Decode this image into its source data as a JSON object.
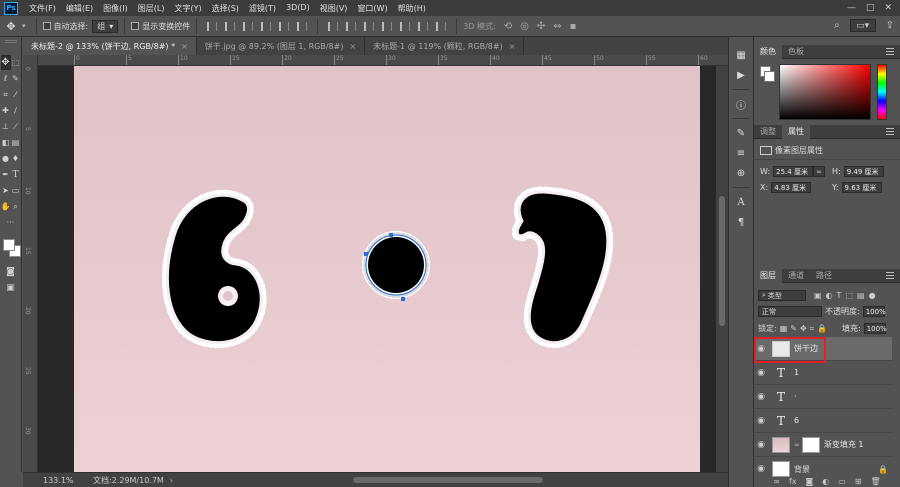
{
  "app": {
    "logo": "Ps"
  },
  "menu": [
    "文件(F)",
    "编辑(E)",
    "图像(I)",
    "图层(L)",
    "文字(Y)",
    "选择(S)",
    "滤镜(T)",
    "3D(D)",
    "视图(V)",
    "窗口(W)",
    "帮助(H)"
  ],
  "options_bar": {
    "auto_select_label": "自动选择:",
    "auto_select_value": "组",
    "show_transform_label": "显示变换控件",
    "mode_label": "3D 模式:"
  },
  "tabs": [
    {
      "label": "未标题-2 @ 133% (饼干边, RGB/8#) *",
      "active": true
    },
    {
      "label": "饼干.jpg @ 89.2% (图层 1, RGB/8#)",
      "active": false
    },
    {
      "label": "未标题-1 @ 119% (颗粒, RGB/8#)",
      "active": false
    }
  ],
  "ruler_top": [
    "0",
    "5",
    "10",
    "15",
    "20",
    "25",
    "30",
    "35",
    "40",
    "45",
    "50",
    "55",
    "60"
  ],
  "ruler_left": [
    "0",
    "5",
    "10",
    "15",
    "20",
    "25",
    "30"
  ],
  "status": {
    "zoom": "133.1%",
    "doc": "文档:2.29M/10.7M"
  },
  "panels": {
    "color_tabs": [
      "颜色",
      "色板"
    ],
    "props_tabs": [
      "调整",
      "属性"
    ],
    "props_title": "像素图层属性",
    "w_label": "W:",
    "w_value": "25.4 厘米",
    "h_label": "H:",
    "h_value": "9.49 厘米",
    "x_label": "X:",
    "x_value": "4.83 厘米",
    "y_label": "Y:",
    "y_value": "9.63 厘米",
    "layers_tabs": [
      "图层",
      "通道",
      "路径"
    ],
    "kind_filter": "类型",
    "blend_mode": "正常",
    "opacity_label": "不透明度:",
    "opacity_value": "100%",
    "lock_label": "锁定:",
    "fill_label": "填充:",
    "fill_value": "100%",
    "layers": [
      {
        "name": "饼干边",
        "type": "pixel",
        "selected": true
      },
      {
        "name": "1",
        "type": "text",
        "selected": false
      },
      {
        "name": "·",
        "type": "text",
        "selected": false
      },
      {
        "name": "6",
        "type": "text",
        "selected": false
      },
      {
        "name": "渐变填充 1",
        "type": "gradient",
        "selected": false
      },
      {
        "name": "背景",
        "type": "background",
        "selected": false
      }
    ]
  },
  "colors": {
    "highlight": "#e0202a",
    "selection": "#2b6fd6",
    "artboard": "#e5c8ce"
  }
}
